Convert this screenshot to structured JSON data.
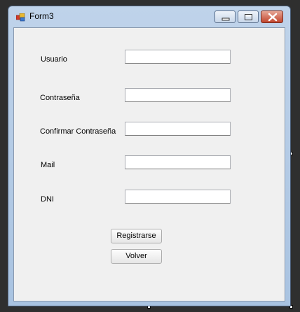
{
  "window": {
    "title": "Form3",
    "icon": "form-icon"
  },
  "titlebar_buttons": {
    "minimize_icon": "minimize-icon",
    "maximize_icon": "maximize-icon",
    "close_icon": "close-icon"
  },
  "form": {
    "fields": [
      {
        "label": "Usuario",
        "value": ""
      },
      {
        "label": "Contraseña",
        "value": ""
      },
      {
        "label": "Confirmar Contraseña",
        "value": ""
      },
      {
        "label": "Mail",
        "value": ""
      },
      {
        "label": "DNI",
        "value": ""
      }
    ],
    "register_button": "Registrarse",
    "back_button": "Volver"
  },
  "colors": {
    "client_background": "#f0f0f0",
    "title_gradient": "#bfd3ea",
    "close_button": "#c2462e"
  }
}
